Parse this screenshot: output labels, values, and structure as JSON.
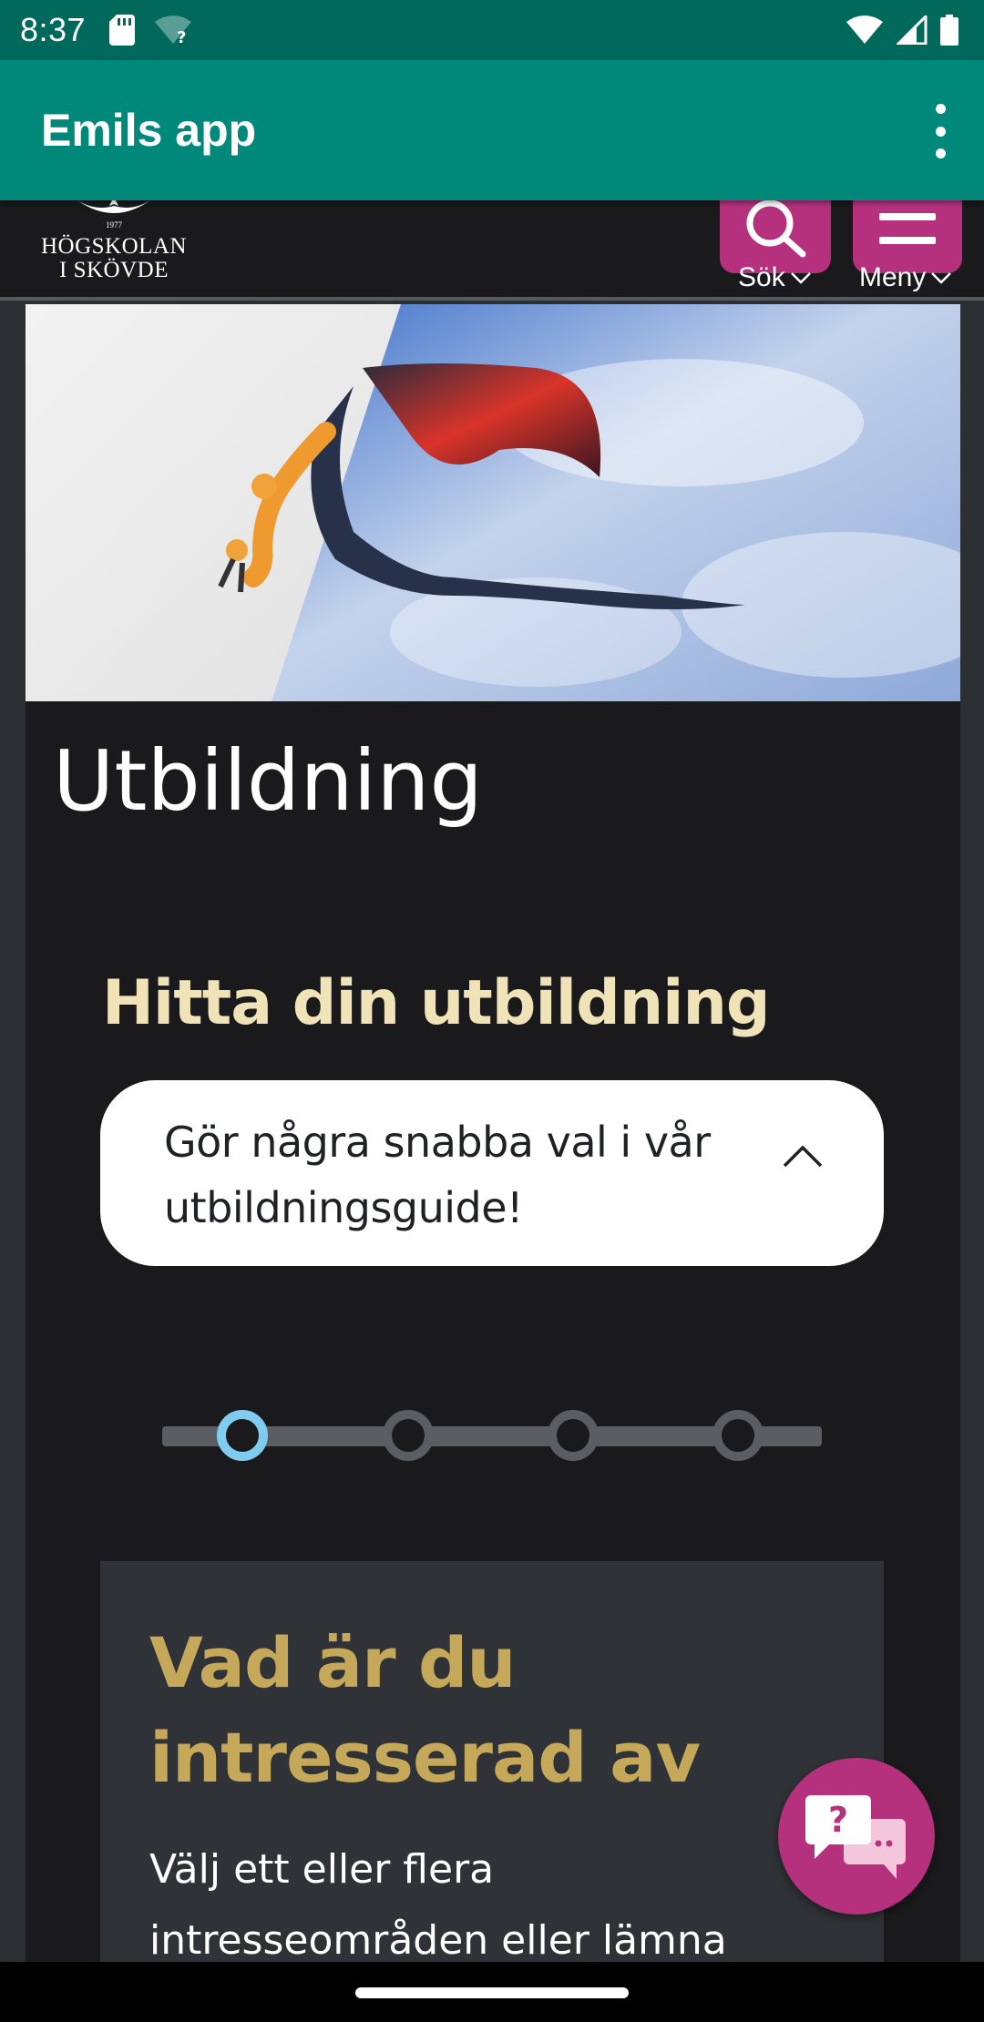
{
  "status_bar": {
    "time": "8:37",
    "icons_left": [
      "sd-card-icon",
      "wifi-question-icon"
    ],
    "icons_right": [
      "wifi-icon",
      "signal-icon",
      "battery-icon"
    ]
  },
  "app_bar": {
    "title": "Emils app",
    "menu_icon": "overflow-menu-icon"
  },
  "site_header": {
    "logo_line1": "HÖGSKOLAN",
    "logo_line2": "I SKÖVDE",
    "logo_year": "1977",
    "search_label": "Sök",
    "menu_label": "Meny"
  },
  "hero": {
    "icon": "hero-dragon-robot-arm-image"
  },
  "main": {
    "page_title": "Utbildning",
    "guide_title": "Hitta din utbildning",
    "accordion_text": "Gör några snabba val i vår utbildningsguide!",
    "stepper": {
      "total_steps": 4,
      "active_step": 1
    },
    "interest_card": {
      "title": "Vad är du intresserad av",
      "description": "Välj ett eller flera intresseområden eller lämna"
    }
  },
  "chat_fab": {
    "icon": "chat-help-icon"
  },
  "colors": {
    "status_bar": "#00695c",
    "app_bar": "#00897b",
    "brand_magenta": "#b5317e",
    "heading_cream": "#f0e3b7",
    "heading_gold": "#c5a85a",
    "stepper_active": "#80ccf0",
    "page_dark": "#1a1a1c"
  }
}
